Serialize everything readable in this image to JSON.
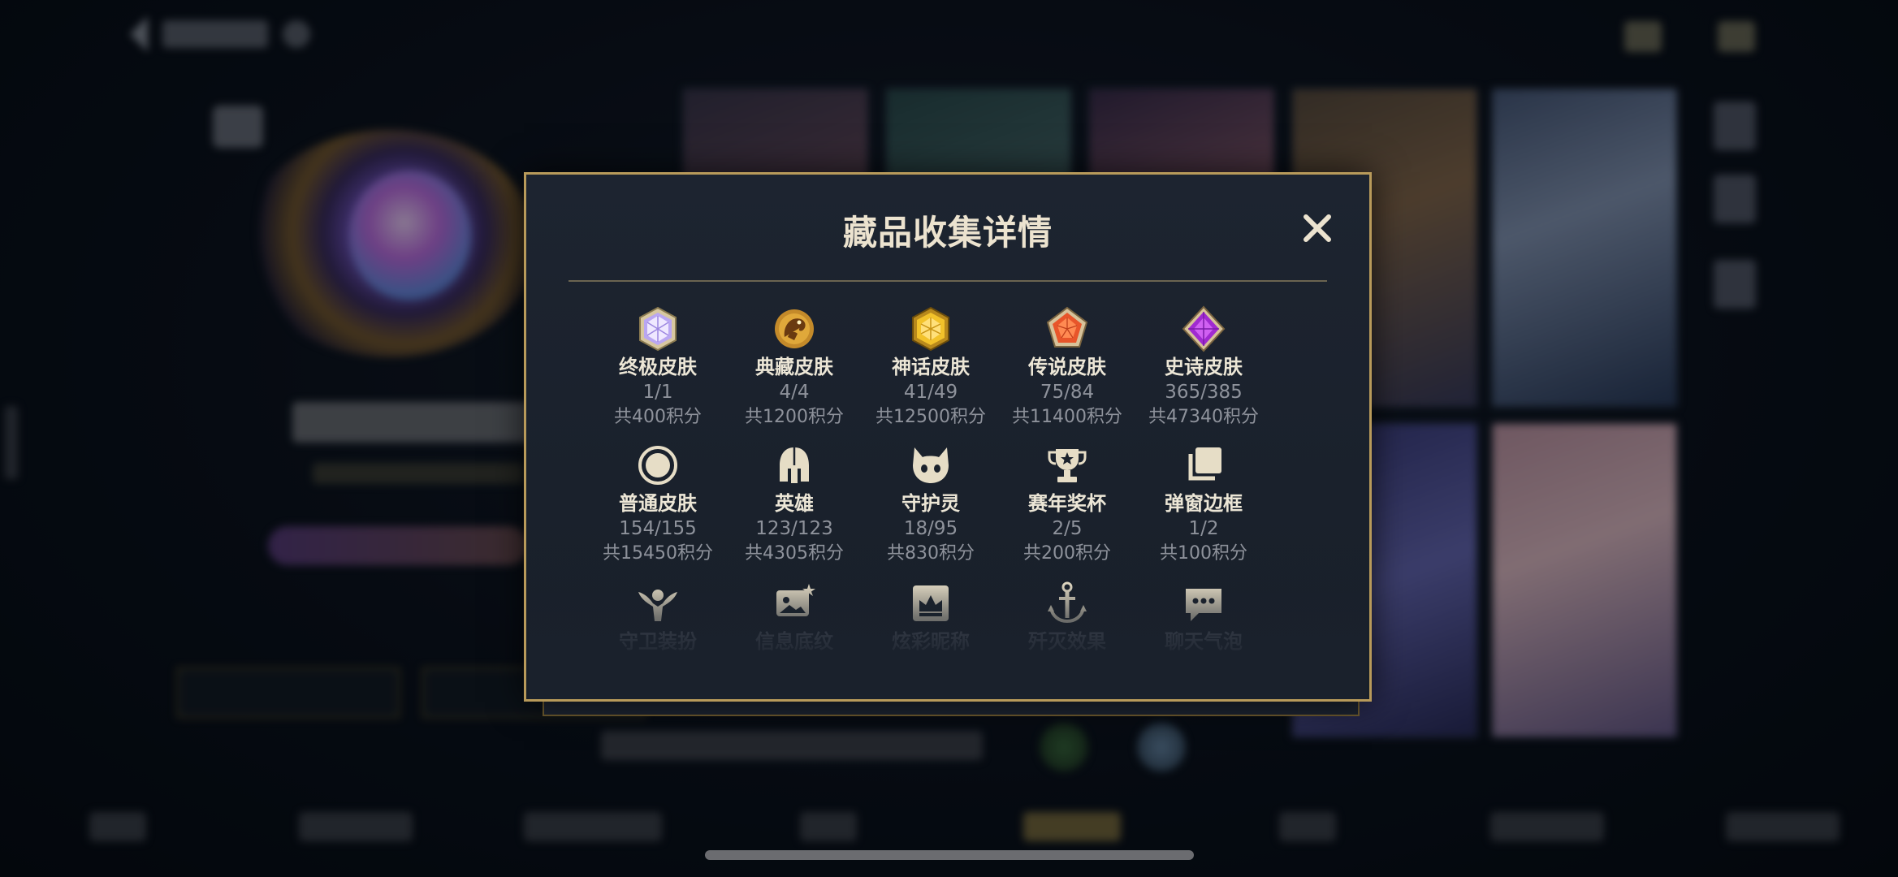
{
  "modal": {
    "title": "藏品收集详情",
    "close_icon": "close-icon",
    "accent_color": "#b89a5a",
    "items": [
      {
        "label": "终极皮肤",
        "count": "1/1",
        "points": "共400积分",
        "icon": "ultimate-skin-gem-icon"
      },
      {
        "label": "典藏皮肤",
        "count": "4/4",
        "points": "共1200积分",
        "icon": "treasure-skin-dragon-icon"
      },
      {
        "label": "神话皮肤",
        "count": "41/49",
        "points": "共12500积分",
        "icon": "mythic-skin-gem-icon"
      },
      {
        "label": "传说皮肤",
        "count": "75/84",
        "points": "共11400积分",
        "icon": "legendary-skin-gem-icon"
      },
      {
        "label": "史诗皮肤",
        "count": "365/385",
        "points": "共47340积分",
        "icon": "epic-skin-gem-icon"
      },
      {
        "label": "普通皮肤",
        "count": "154/155",
        "points": "共15450积分",
        "icon": "normal-skin-circle-icon"
      },
      {
        "label": "英雄",
        "count": "123/123",
        "points": "共4305积分",
        "icon": "hero-helmet-icon"
      },
      {
        "label": "守护灵",
        "count": "18/95",
        "points": "共830积分",
        "icon": "guardian-spirit-icon"
      },
      {
        "label": "赛年奖杯",
        "count": "2/5",
        "points": "共200积分",
        "icon": "season-trophy-icon"
      },
      {
        "label": "弹窗边框",
        "count": "1/2",
        "points": "共100积分",
        "icon": "popup-frame-icon"
      },
      {
        "label": "守卫装扮",
        "icon": "ward-skin-icon"
      },
      {
        "label": "信息底纹",
        "icon": "info-background-icon"
      },
      {
        "label": "炫彩昵称",
        "icon": "colorful-nickname-icon"
      },
      {
        "label": "歼灭效果",
        "icon": "ace-effect-icon"
      },
      {
        "label": "聊天气泡",
        "icon": "chat-bubble-icon"
      }
    ]
  }
}
